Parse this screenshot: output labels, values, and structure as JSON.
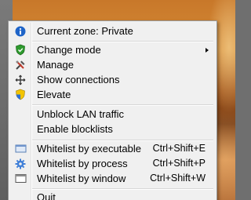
{
  "menu": {
    "current_zone": {
      "label": "Current zone: Private",
      "icon": "info-icon"
    },
    "change_mode": {
      "label": "Change mode",
      "icon": "shield-icon",
      "has_submenu": true
    },
    "manage": {
      "label": "Manage",
      "icon": "tools-icon"
    },
    "show_connections": {
      "label": "Show connections",
      "icon": "network-icon"
    },
    "elevate": {
      "label": "Elevate",
      "icon": "uac-shield-icon"
    },
    "unblock_lan": {
      "label": "Unblock LAN traffic"
    },
    "enable_blocklists": {
      "label": "Enable blocklists"
    },
    "whitelist_executable": {
      "label": "Whitelist by executable",
      "shortcut": "Ctrl+Shift+E",
      "icon": "executable-icon"
    },
    "whitelist_process": {
      "label": "Whitelist by process",
      "shortcut": "Ctrl+Shift+P",
      "icon": "gear-icon"
    },
    "whitelist_window": {
      "label": "Whitelist by window",
      "shortcut": "Ctrl+Shift+W",
      "icon": "window-icon"
    },
    "quit": {
      "label": "Quit"
    }
  },
  "colors": {
    "menu_bg": "#f0f0f0",
    "menu_border": "#979797",
    "info_blue": "#1e64c8",
    "shield_green": "#2e9a2e"
  }
}
